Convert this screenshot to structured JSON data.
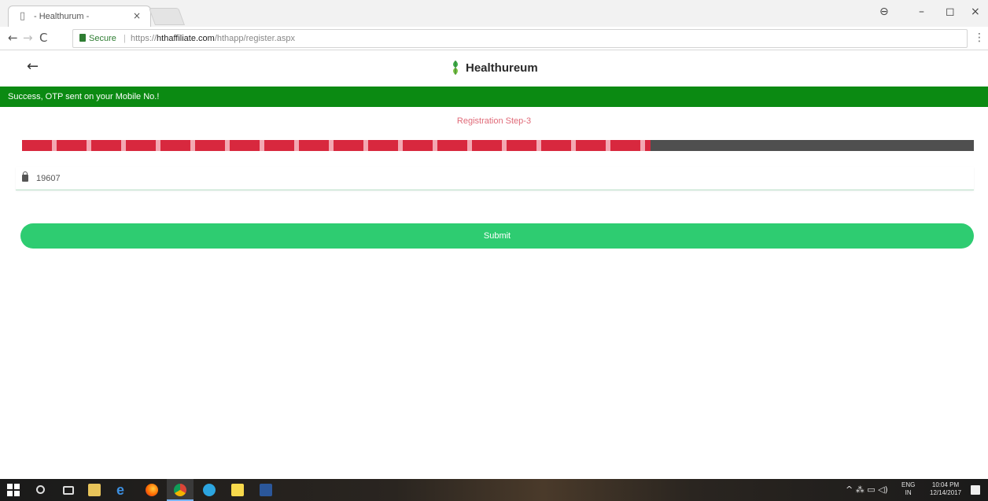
{
  "browser": {
    "tab_title": "- Healthurum -",
    "tab_page_glyph": "▯",
    "tab_close_glyph": "×",
    "profile_glyph": "⊖",
    "minimize_glyph": "–",
    "maximize_glyph": "◻",
    "close_glyph": "×",
    "back_glyph": "←",
    "forward_glyph": "→",
    "reload_glyph": "C",
    "secure_label": "Secure",
    "url_separator": "|",
    "url_scheme": "https://",
    "url_domain": "hthaffiliate.com",
    "url_path": "/hthapp/register.aspx",
    "star_glyph": "☆",
    "menu_glyph": "⋮"
  },
  "app": {
    "back_glyph": "←",
    "brand_name": "Healthureum",
    "brand_color": "#2e7d32"
  },
  "alert": {
    "message": "Success, OTP sent on your Mobile No.!",
    "color": "#0b8a12"
  },
  "form": {
    "step_title": "Registration Step-3",
    "progress_percent": 66,
    "otp_value": "19607",
    "submit_label": "Submit",
    "submit_color": "#2ecc71"
  },
  "taskbar": {
    "edge_glyph": "e",
    "tray_glyphs": "^ ⁂ ▭ ◁)",
    "language_line1": "ENG",
    "language_line2": "IN",
    "time": "10:04 PM",
    "date": "12/14/2017"
  }
}
